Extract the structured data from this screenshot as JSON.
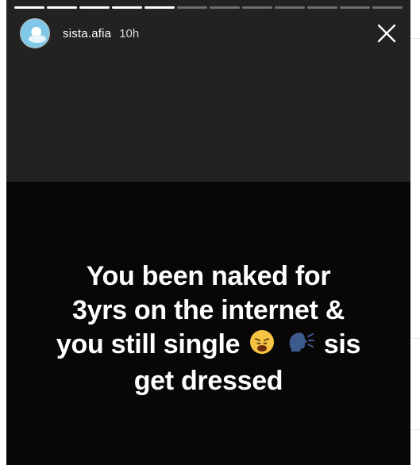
{
  "story": {
    "progress": {
      "total": 12,
      "completed": 5
    },
    "user": {
      "username": "sista.afia",
      "time": "10h"
    },
    "caption": {
      "line1": "You been naked for",
      "line2": "3yrs on the internet &",
      "line3_before": "you still single",
      "line3_after": "sis",
      "line4": "get dressed"
    },
    "icons": [
      "avatar",
      "close-icon",
      "weary-face-emoji",
      "speaking-head-emoji"
    ]
  }
}
